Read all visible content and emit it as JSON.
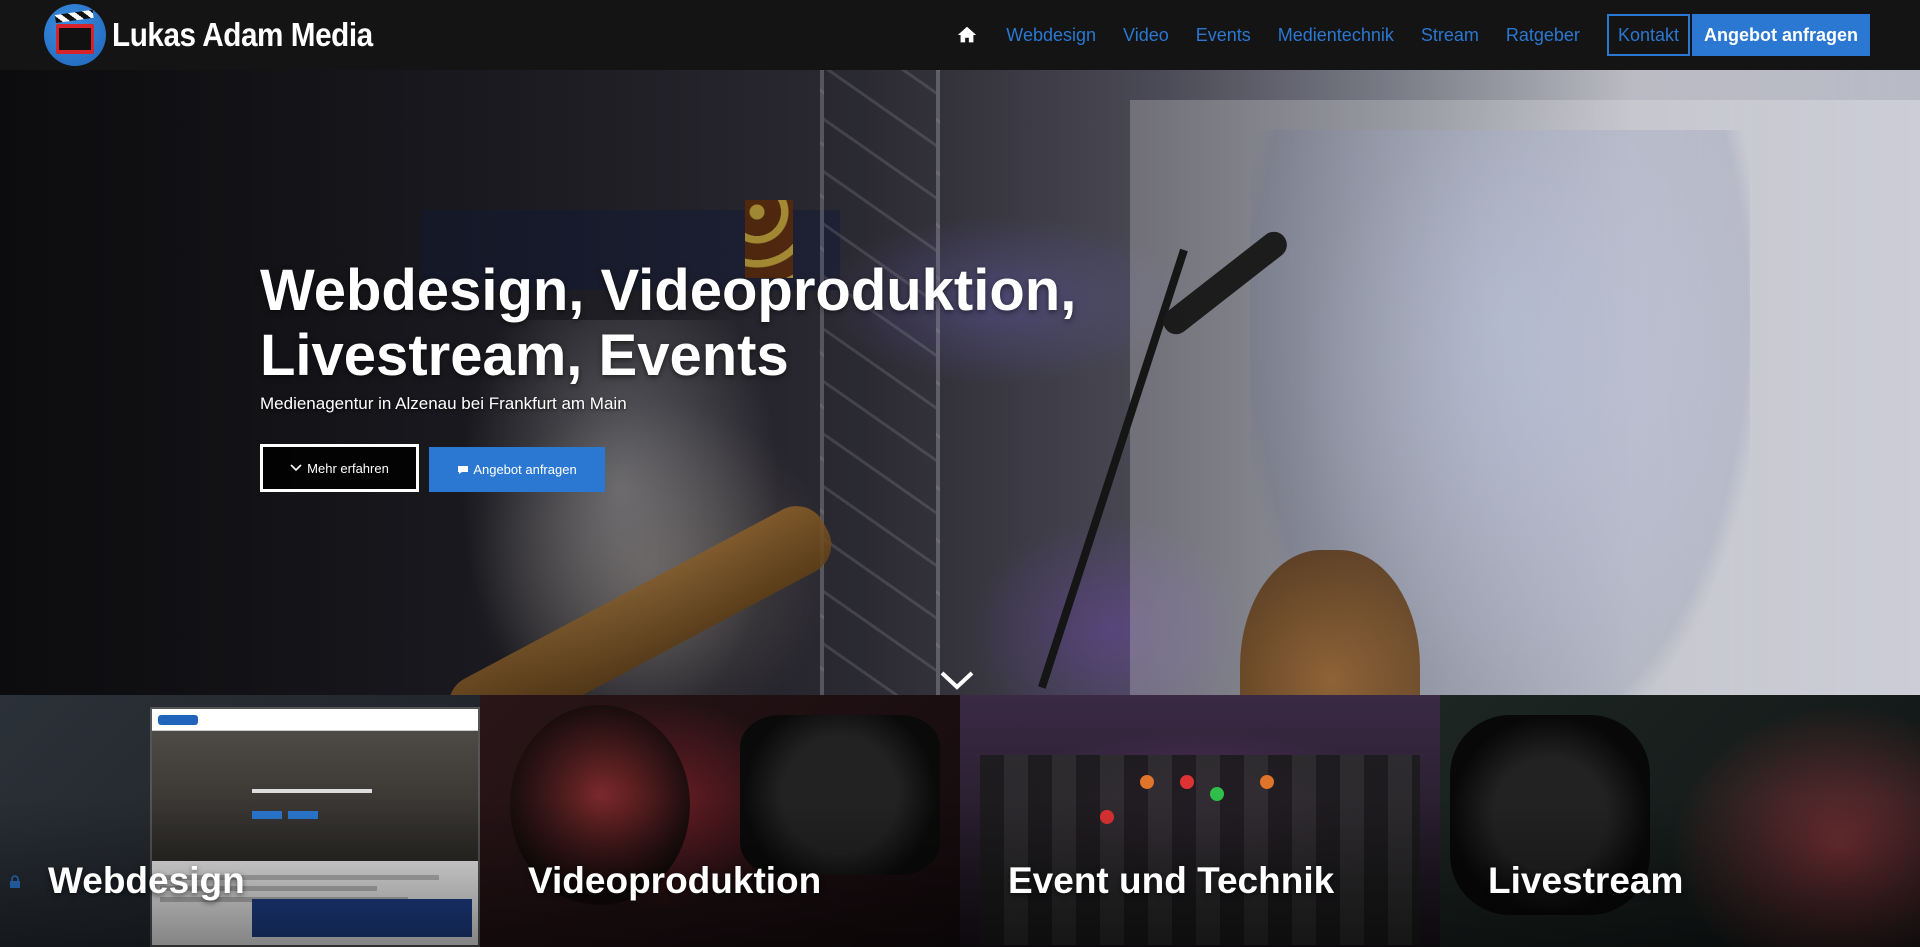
{
  "navbar": {
    "brand": "Lukas Adam Media",
    "links": [
      "Webdesign",
      "Video",
      "Events",
      "Medientechnik",
      "Stream",
      "Ratgeber"
    ],
    "contact": "Kontakt",
    "cta": "Angebot anfragen",
    "home_icon": "home-icon",
    "accent": "#2a78d1"
  },
  "hero": {
    "title_line1": "Webdesign, Videoproduktion,",
    "title_line2": "Livestream, Events",
    "subtitle": "Medienagentur in Alzenau bei Frankfurt am Main",
    "btn_more": "Mehr erfahren",
    "btn_quote": "Angebot anfragen"
  },
  "tiles": [
    {
      "label": "Webdesign"
    },
    {
      "label": "Videoproduktion"
    },
    {
      "label": "Event und Technik"
    },
    {
      "label": "Livestream"
    }
  ]
}
